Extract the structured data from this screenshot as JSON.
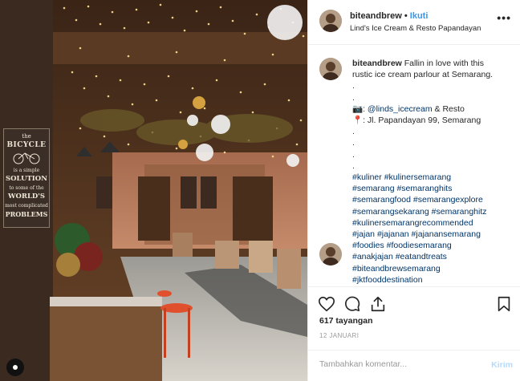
{
  "post": {
    "username": "biteandbrew",
    "separator": "•",
    "follow_label": "Ikuti",
    "location": "Lind's Ice Cream & Resto Papandayan",
    "more_label": "•••"
  },
  "caption": {
    "author": "biteandbrew",
    "lines": [
      "Fallin in love with this",
      "rustic ice cream parlour at Semarang."
    ],
    "dots_a": [
      ".",
      "."
    ],
    "camera_emoji": "📷:",
    "mention": "@linds_icecream",
    "mention_suffix": "& Resto",
    "pin_emoji": "📍:",
    "address": "Jl. Papandayan 99, Semarang",
    "dots_b": [
      ".",
      ".",
      ".",
      "."
    ],
    "hashtag_lines": [
      "#kuliner #kulinersemarang",
      "#semarang #semaranghits",
      "#semarangfood #semarangexplore",
      "#semarangsekarang #semaranghitz",
      "#kulinersemarangrecommended",
      "#jajan #jajanan #jajanansemarang",
      "#foodies #foodiesemarang",
      "#anakjajan #eatandtreats",
      "#biteandbrewsemarang",
      "#jktfooddestination"
    ]
  },
  "stats": {
    "views": "617 tayangan",
    "date": "12 JANUARI"
  },
  "comment": {
    "placeholder": "Tambahkan komentar...",
    "post_label": "Kirim"
  },
  "photo": {
    "sign_lines": [
      "the",
      "BICYCLE",
      "is a simple",
      "SOLUTION",
      "to some of the",
      "WORLD'S",
      "most complicated",
      "PROBLEMS"
    ]
  },
  "colors": {
    "link": "#3897f0",
    "text": "#262626",
    "muted": "#999999",
    "hashtag": "#003569"
  },
  "icons": [
    "heart-icon",
    "comment-icon",
    "share-icon",
    "bookmark-icon",
    "more-options-icon"
  ]
}
